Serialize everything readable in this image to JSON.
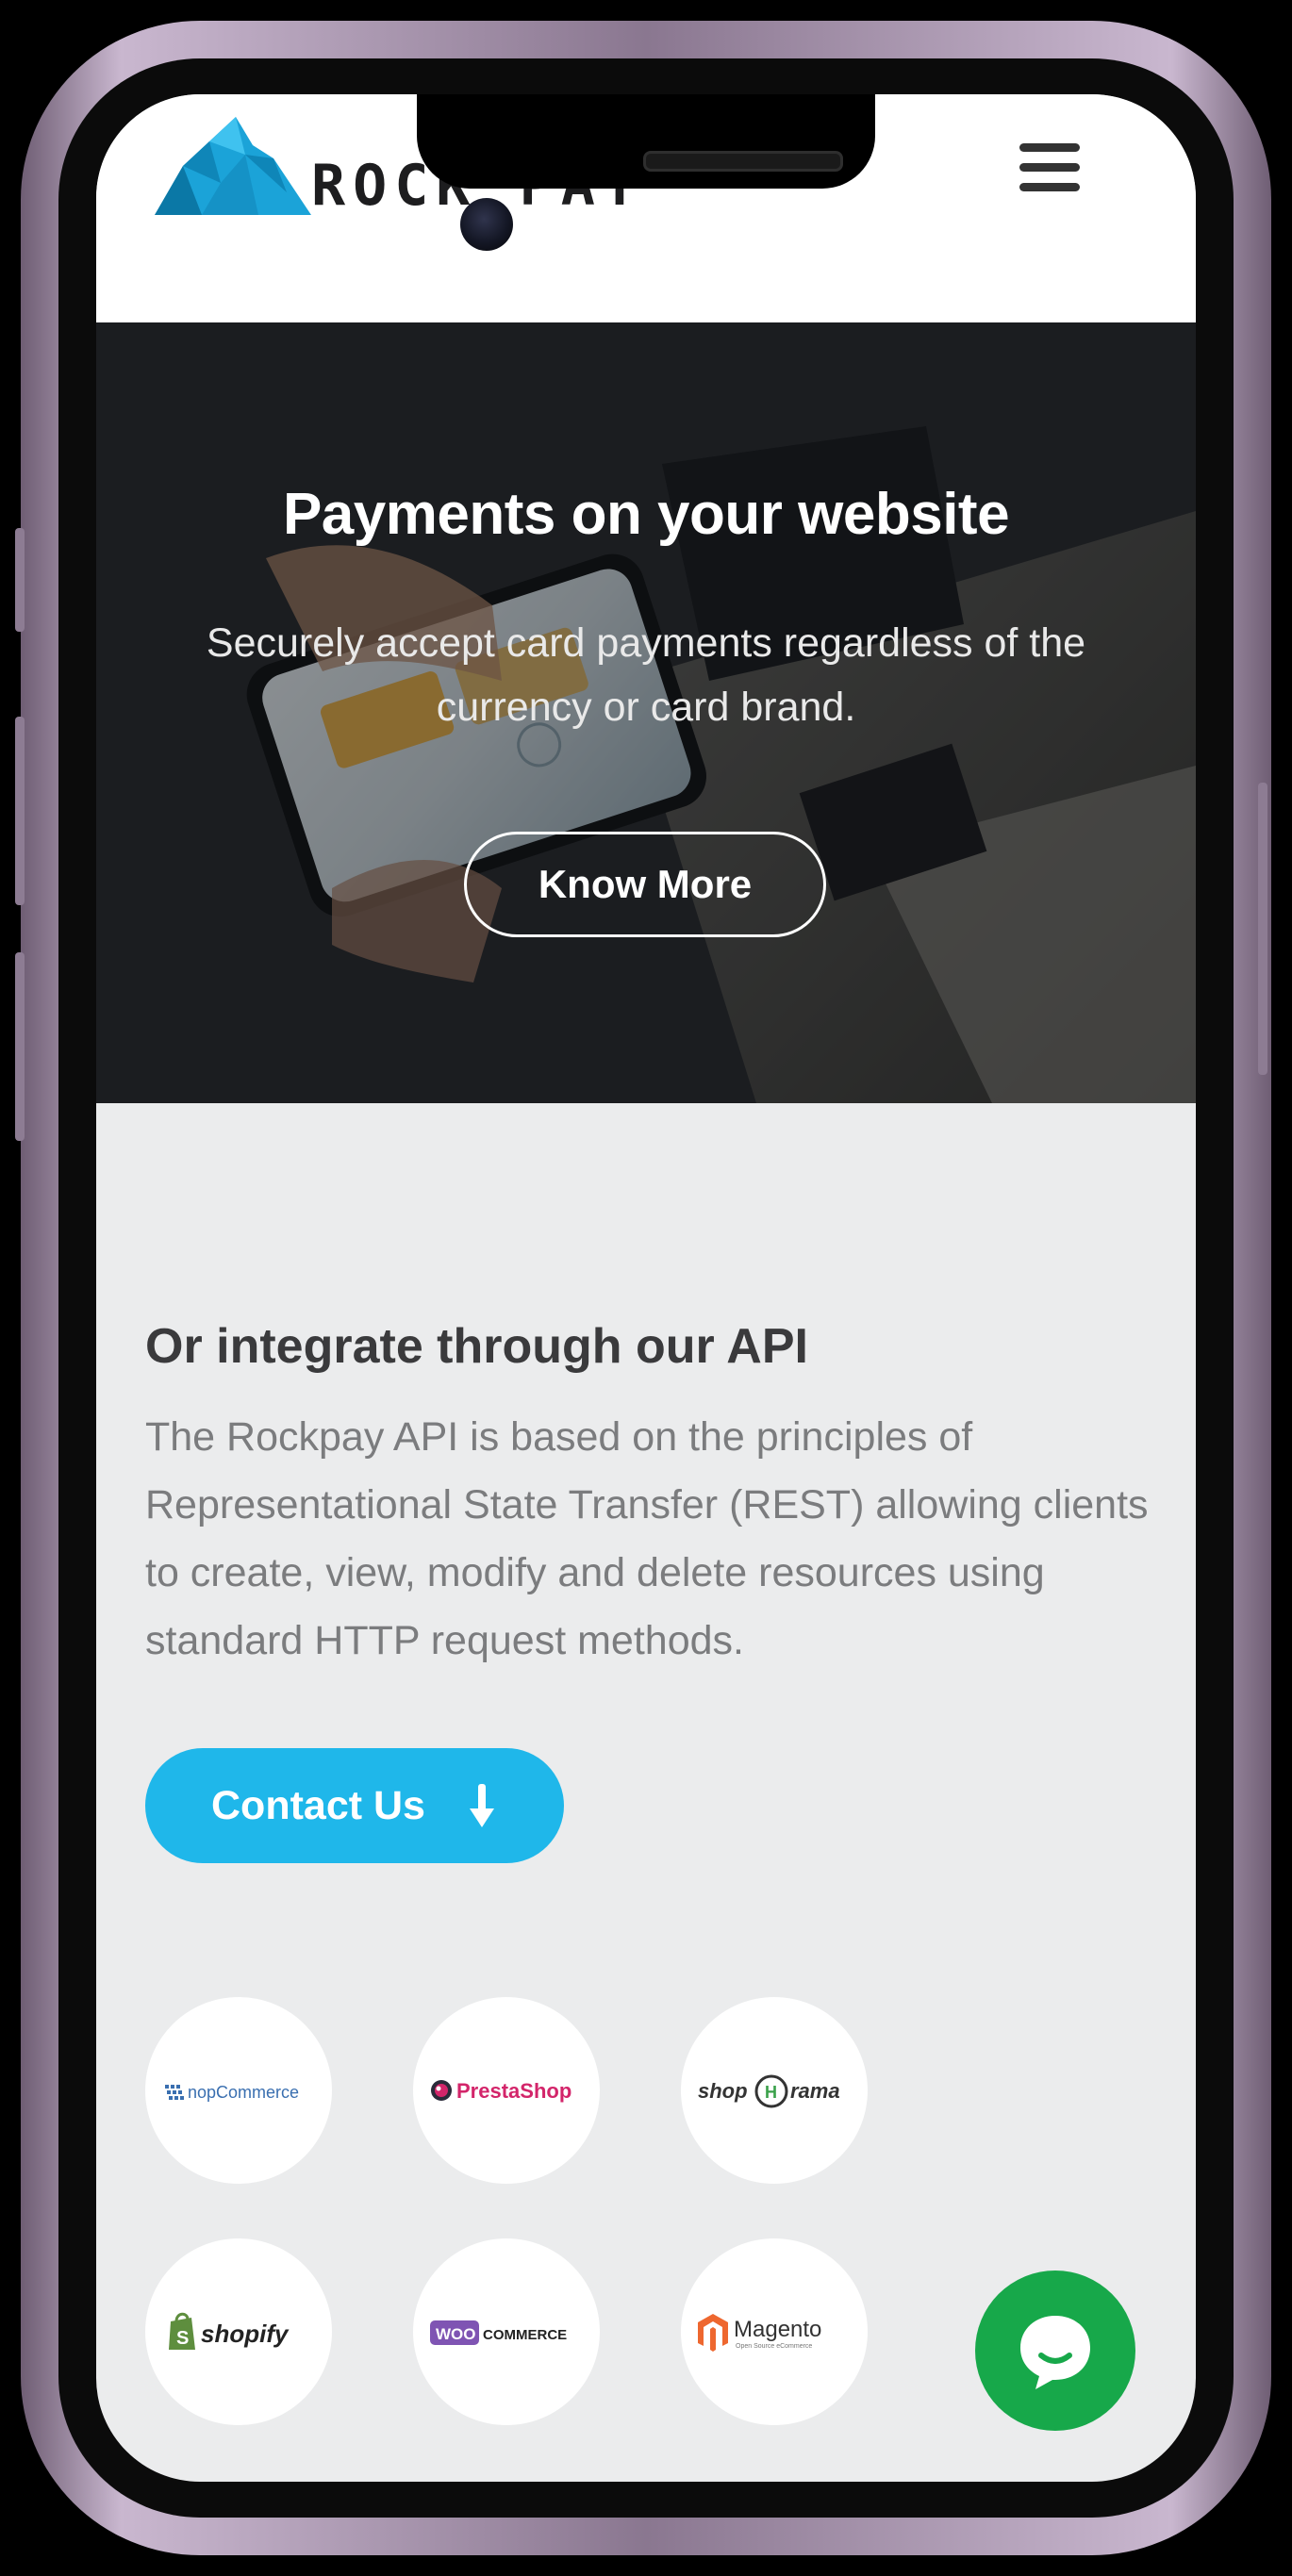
{
  "header": {
    "logo_text": "ROCK PAY",
    "menu_icon": "hamburger-menu-icon",
    "brand_color": "#1aa6d9"
  },
  "hero": {
    "title": "Payments on your website",
    "subtitle": "Securely accept card payments regardless of the currency or card brand.",
    "button_label": "Know More"
  },
  "api": {
    "title": "Or integrate through our API",
    "body": "The Rockpay API is based on the principles of Representational State Transfer (REST) allowing clients to create, view, modify and delete resources using standard HTTP request methods.",
    "contact_label": "Contact Us",
    "contact_icon": "arrow-down-icon",
    "accent_color": "#1fb7ea"
  },
  "platforms": [
    {
      "name": "nopCommerce",
      "logo_text": "nopCommerce"
    },
    {
      "name": "PrestaShop",
      "logo_text": "PrestaShop"
    },
    {
      "name": "Shoporama",
      "logo_text": "shop rama"
    },
    {
      "name": "Shopify",
      "logo_text": "shopify"
    },
    {
      "name": "WooCommerce",
      "logo_text": "WOO COMMERCE"
    },
    {
      "name": "Magento",
      "logo_text": "Magento",
      "logo_sub": "Open Source eCommerce"
    }
  ],
  "chat": {
    "icon": "chat-bubble-icon",
    "color": "#17a84a"
  }
}
